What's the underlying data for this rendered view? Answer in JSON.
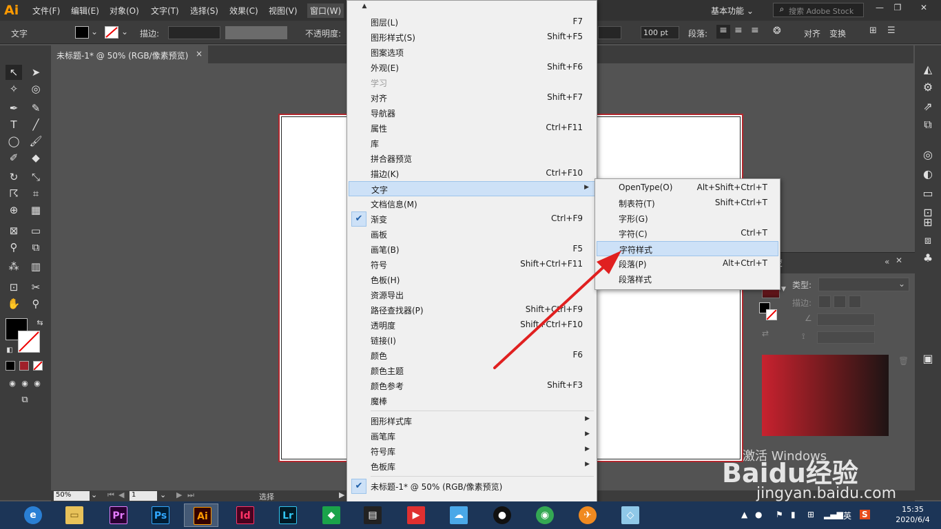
{
  "app": {
    "logo": "Ai"
  },
  "menubar": {
    "items": [
      "文件(F)",
      "编辑(E)",
      "对象(O)",
      "文字(T)",
      "选择(S)",
      "效果(C)",
      "视图(V)",
      "窗口(W)"
    ],
    "workspace": "基本功能",
    "search_placeholder": "搜索 Adobe Stock"
  },
  "controlbar": {
    "mode_label": "文字",
    "stroke_label": "描边:",
    "opacity_label": "不透明度:",
    "size_value": "100 pt",
    "paragraph_label": "段落:",
    "align_label": "对齐",
    "transform_label": "变换"
  },
  "document": {
    "tab_title": "未标题-1* @ 50% (RGB/像素预览)",
    "close": "×"
  },
  "window_menu": {
    "items": [
      {
        "label": "图层(L)",
        "shortcut": "F7"
      },
      {
        "label": "图形样式(S)",
        "shortcut": "Shift+F5"
      },
      {
        "label": "图案选项",
        "shortcut": ""
      },
      {
        "label": "外观(E)",
        "shortcut": "Shift+F6"
      },
      {
        "label": "学习",
        "shortcut": ""
      },
      {
        "label": "对齐",
        "shortcut": "Shift+F7"
      },
      {
        "label": "导航器",
        "shortcut": ""
      },
      {
        "label": "属性",
        "shortcut": "Ctrl+F11"
      },
      {
        "label": "库",
        "shortcut": ""
      },
      {
        "label": "拼合器预览",
        "shortcut": ""
      },
      {
        "label": "描边(K)",
        "shortcut": "Ctrl+F10"
      },
      {
        "label": "文字",
        "shortcut": ""
      },
      {
        "label": "文档信息(M)",
        "shortcut": ""
      },
      {
        "label": "渐变",
        "shortcut": "Ctrl+F9"
      },
      {
        "label": "画板",
        "shortcut": ""
      },
      {
        "label": "画笔(B)",
        "shortcut": "F5"
      },
      {
        "label": "符号",
        "shortcut": "Shift+Ctrl+F11"
      },
      {
        "label": "色板(H)",
        "shortcut": ""
      },
      {
        "label": "资源导出",
        "shortcut": ""
      },
      {
        "label": "路径查找器(P)",
        "shortcut": "Shift+Ctrl+F9"
      },
      {
        "label": "透明度",
        "shortcut": "Shift+Ctrl+F10"
      },
      {
        "label": "链接(I)",
        "shortcut": ""
      },
      {
        "label": "颜色",
        "shortcut": "F6"
      },
      {
        "label": "颜色主题",
        "shortcut": ""
      },
      {
        "label": "颜色参考",
        "shortcut": "Shift+F3"
      },
      {
        "label": "魔棒",
        "shortcut": ""
      }
    ],
    "libraries": [
      "图形样式库",
      "画笔库",
      "符号库",
      "色板库"
    ],
    "open_document": "未标题-1* @ 50% (RGB/像素预览)"
  },
  "type_submenu": {
    "items": [
      {
        "label": "OpenType(O)",
        "shortcut": "Alt+Shift+Ctrl+T"
      },
      {
        "label": "制表符(T)",
        "shortcut": "Shift+Ctrl+T"
      },
      {
        "label": "字形(G)",
        "shortcut": ""
      },
      {
        "label": "字符(C)",
        "shortcut": "Ctrl+T"
      },
      {
        "label": "字符样式",
        "shortcut": ""
      },
      {
        "label": "段落(P)",
        "shortcut": "Alt+Ctrl+T"
      },
      {
        "label": "段落样式",
        "shortcut": ""
      }
    ]
  },
  "gradient_panel": {
    "type_label": "类型:",
    "stroke_label": "描边:",
    "tab_label": "变"
  },
  "statusbar": {
    "zoom": "50%",
    "artboard": "1",
    "tool": "选择"
  },
  "taskbar": {
    "apps": [
      "Pr",
      "Ps",
      "Ai",
      "Id",
      "Lr"
    ],
    "ime": "英",
    "time": "15:35",
    "date": "2020/6/4"
  },
  "watermark": {
    "activate": "激活 Windows",
    "site": "jingyan.baidu.com",
    "brand": "Baidu经验"
  },
  "colors": {
    "menu_highlight": "#cde1f7",
    "artboard_border": "#b2282e",
    "arrow": "#e02020",
    "ai_orange": "#ff9a00"
  }
}
